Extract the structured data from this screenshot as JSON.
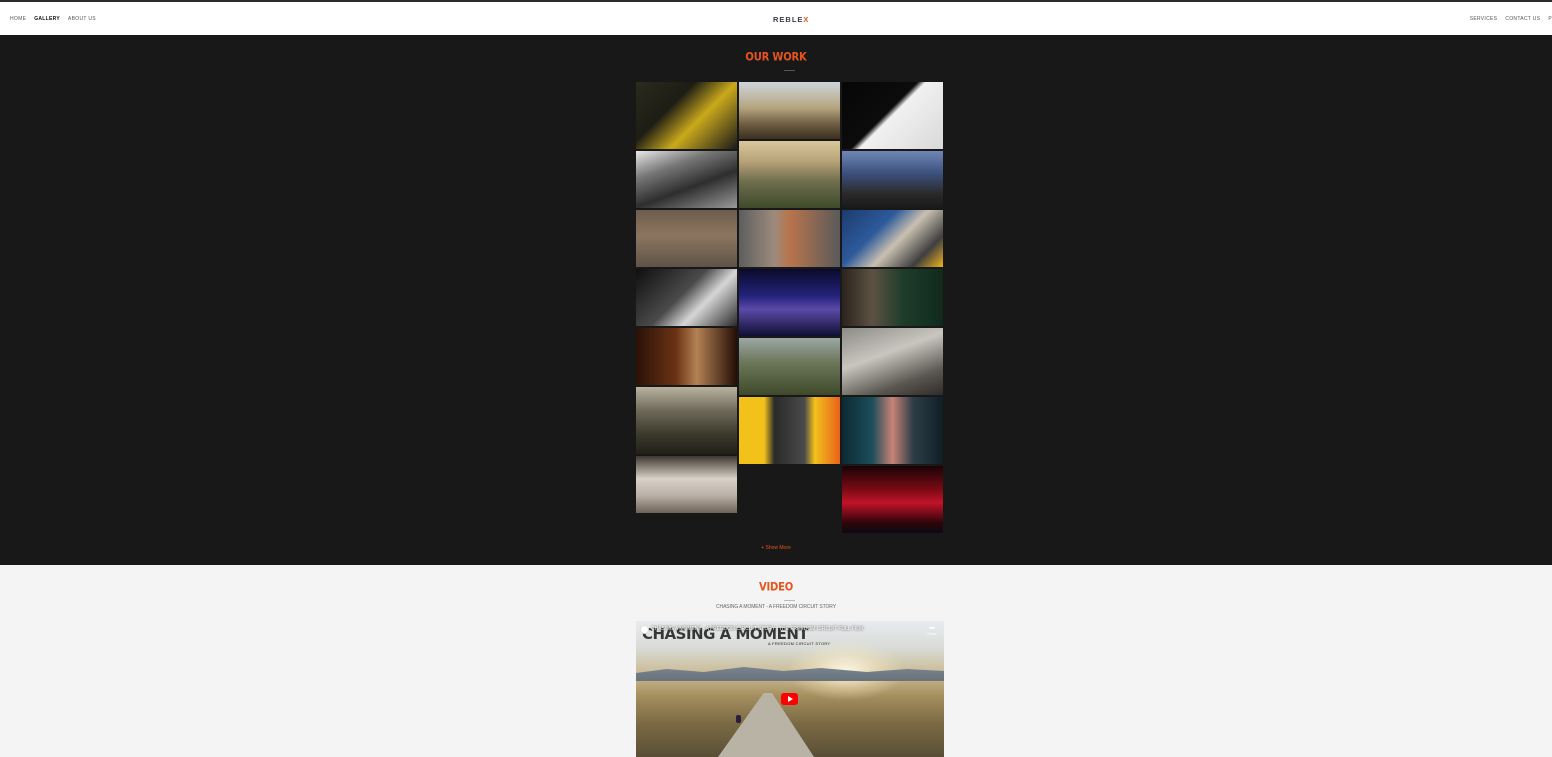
{
  "nav": {
    "left": [
      "HOME",
      "GALLERY",
      "ABOUT US"
    ],
    "active": "GALLERY",
    "right": [
      "SERVICES",
      "CONTACT US",
      "P"
    ]
  },
  "logo": {
    "main": "REBLE",
    "accent": "X"
  },
  "work": {
    "title": "OUR WORK",
    "show_more": "+ Show More"
  },
  "gallery_tiles": [
    "cyclist-drinking-yellow-jersey",
    "rider-on-horse-mountains",
    "cyclist-shadow-diagonal",
    "boxer-black-and-white",
    "tractor-field-sunset",
    "runner-mountain-dusk",
    "farm-field-drone",
    "boxer-back-gym",
    "cyclist-muddy-shoe",
    "guitar-black-and-white",
    "guitarist-stage-blue",
    "shearing-shed-green",
    "man-in-kitchen-window",
    "winding-road-valley",
    "sheep-pen-feeding",
    "farmer-eating-corn",
    "runner-yellow-stairs",
    "train-station-cyclist",
    "sheep-faces-row",
    "concert-crowd-red"
  ],
  "video": {
    "title": "VIDEO",
    "subtitle": "CHASING A MOMENT - A FREEDOM CIRCUIT STORY",
    "player_title": "CHASING A MOMENT - A FREEDOM CIRCUIT STORY | THE FREEDOM CIRCUIT FULL FILM",
    "overlay_title": "CHASING A MOMENT",
    "overlay_sub": "A FREEDOM CIRCUIT STORY",
    "share_label": "Share"
  },
  "colors": {
    "accent": "#e8541e",
    "dark_bg": "#181818",
    "light_bg": "#f4f4f4"
  }
}
